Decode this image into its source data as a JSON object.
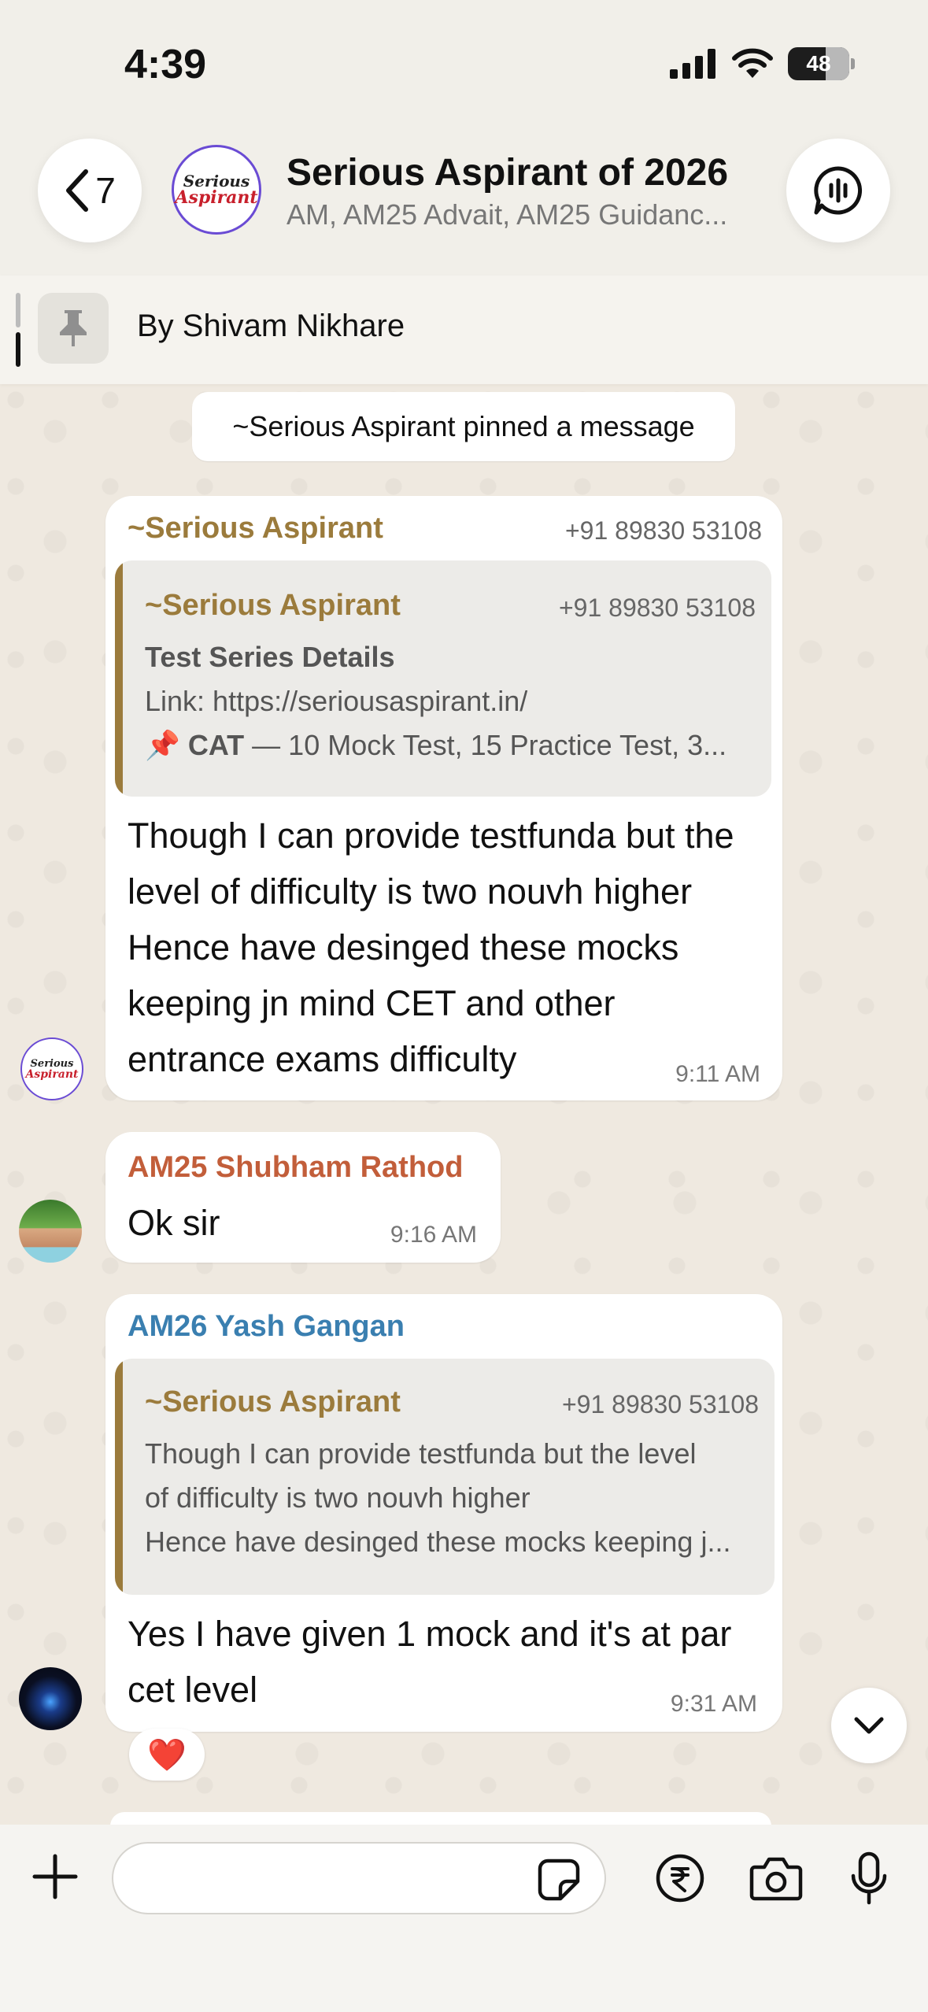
{
  "status_bar": {
    "time": "4:39",
    "battery": "48"
  },
  "header": {
    "back_count": "7",
    "avatar_line1": "Serious",
    "avatar_line2": "Aspirant",
    "title": "Serious Aspirant of 2026",
    "members": "AM, AM25 Advait, AM25 Guidanc..."
  },
  "pinned": {
    "text": "By Shivam Nikhare"
  },
  "system_message": "~Serious Aspirant pinned a message",
  "messages": [
    {
      "sender": "~Serious Aspirant",
      "phone": "+91 89830 53108",
      "quote": {
        "sender": "~Serious Aspirant",
        "phone": "+91 89830 53108",
        "title": "Test Series Details",
        "link": "Link: https://seriousaspirant.in/",
        "line3_emoji": "📌",
        "line3_bold": "CAT",
        "line3_rest": " — 10 Mock Test, 15 Practice Test, 3..."
      },
      "lines": [
        "Though I can provide testfunda but the",
        "level of difficulty is two nouvh higher",
        "Hence have desinged these mocks",
        "keeping jn mind CET and other",
        "entrance exams difficulty"
      ],
      "time": "9:11 AM",
      "sender_color": "#9b7b3c"
    },
    {
      "sender": "AM25 Shubham Rathod",
      "text": "Ok sir",
      "time": "9:16 AM",
      "sender_color": "#c25e3a"
    },
    {
      "sender": "AM26 Yash Gangan",
      "quote": {
        "sender": "~Serious Aspirant",
        "phone": "+91 89830 53108",
        "lines": [
          "Though I can provide testfunda but the level",
          "of difficulty is two nouvh higher",
          "Hence have desinged these mocks keeping j..."
        ]
      },
      "lines": [
        "Yes I have given 1 mock and it's at par",
        "cet level"
      ],
      "time": "9:31 AM",
      "reaction": "❤️",
      "sender_color": "#3a7fb0"
    }
  ],
  "colors": {
    "accent_gold": "#9b7b3c",
    "chat_bg": "#efe9e0"
  },
  "icons": [
    "back-chevron-icon",
    "voice-chat-icon",
    "pin-icon",
    "plus-icon",
    "sticker-icon",
    "rupee-icon",
    "camera-icon",
    "microphone-icon",
    "chevron-down-icon"
  ]
}
